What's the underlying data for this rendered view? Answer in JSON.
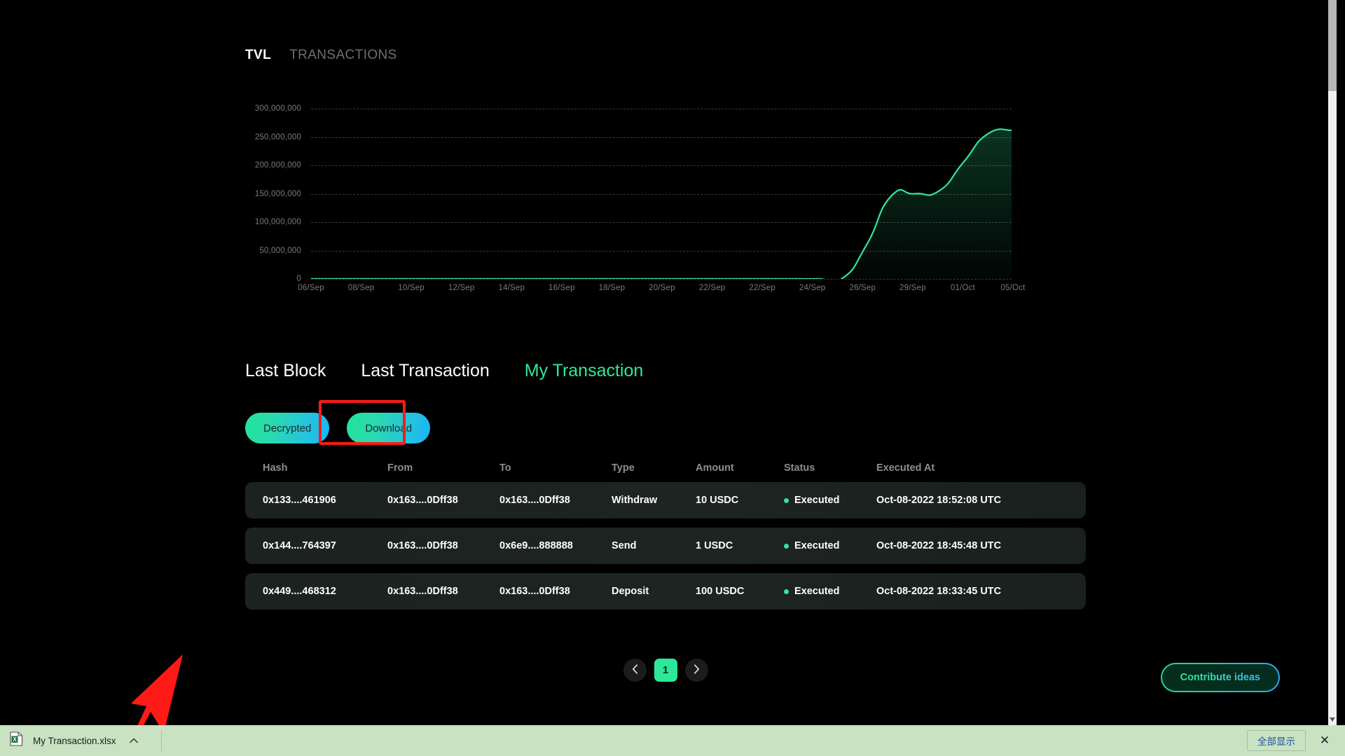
{
  "chart_tabs": [
    {
      "label": "TVL",
      "active": true
    },
    {
      "label": "TRANSACTIONS",
      "active": false
    }
  ],
  "chart_data": {
    "type": "area",
    "title": "TVL",
    "xlabel": "",
    "ylabel": "",
    "ylim": [
      0,
      300000000
    ],
    "grid": true,
    "legend": "none",
    "line_color": "#2ee89a",
    "fill_color": "#0d2b22",
    "ytick_labels": [
      "300,000,000",
      "250,000,000",
      "200,000,000",
      "150,000,000",
      "100,000,000",
      "50,000,000",
      "0"
    ],
    "ytick_values": [
      300000000,
      250000000,
      200000000,
      150000000,
      100000000,
      50000000,
      0
    ],
    "xtick_labels": [
      "06/Sep",
      "08/Sep",
      "10/Sep",
      "12/Sep",
      "14/Sep",
      "16/Sep",
      "18/Sep",
      "20/Sep",
      "22/Sep",
      "22/Sep",
      "24/Sep",
      "26/Sep",
      "29/Sep",
      "01/Oct",
      "05/Oct"
    ],
    "x": [
      "06/Sep",
      "07/Sep",
      "08/Sep",
      "09/Sep",
      "10/Sep",
      "11/Sep",
      "12/Sep",
      "13/Sep",
      "14/Sep",
      "15/Sep",
      "16/Sep",
      "17/Sep",
      "18/Sep",
      "19/Sep",
      "20/Sep",
      "21/Sep",
      "22/Sep",
      "23/Sep",
      "24/Sep",
      "25/Sep",
      "26/Sep",
      "27/Sep",
      "28/Sep",
      "29/Sep",
      "30/Sep",
      "01/Oct",
      "02/Oct",
      "03/Oct",
      "04/Oct",
      "05/Oct"
    ],
    "values": [
      0,
      0,
      0,
      0,
      0,
      0,
      0,
      0,
      0,
      0,
      0,
      0,
      0,
      0,
      0,
      0,
      0,
      0,
      0,
      0,
      0,
      0,
      1000000,
      60000000,
      145000000,
      150000000,
      155000000,
      205000000,
      255000000,
      262000000
    ]
  },
  "section_tabs": [
    {
      "label": "Last Block",
      "active": false
    },
    {
      "label": "Last Transaction",
      "active": false
    },
    {
      "label": "My Transaction",
      "active": true
    }
  ],
  "actions": {
    "decrypted_label": "Decrypted",
    "download_label": "Download"
  },
  "table": {
    "headers": [
      "Hash",
      "From",
      "To",
      "Type",
      "Amount",
      "Status",
      "Executed At"
    ],
    "rows": [
      {
        "hash": "0x133....461906",
        "from": "0x163....0Dff38",
        "to": "0x163....0Dff38",
        "type": "Withdraw",
        "amount": "10 USDC",
        "status": "Executed",
        "executed_at": "Oct-08-2022 18:52:08 UTC"
      },
      {
        "hash": "0x144....764397",
        "from": "0x163....0Dff38",
        "to": "0x6e9....888888",
        "type": "Send",
        "amount": "1 USDC",
        "status": "Executed",
        "executed_at": "Oct-08-2022 18:45:48 UTC"
      },
      {
        "hash": "0x449....468312",
        "from": "0x163....0Dff38",
        "to": "0x163....0Dff38",
        "type": "Deposit",
        "amount": "100 USDC",
        "status": "Executed",
        "executed_at": "Oct-08-2022 18:33:45 UTC"
      }
    ]
  },
  "pagination": {
    "prev_icon": "chevron-left-icon",
    "next_icon": "chevron-right-icon",
    "current_page": "1"
  },
  "contribute": {
    "label": "Contribute ideas"
  },
  "download_bar": {
    "file_icon": "excel-file-icon",
    "filename": "My Transaction.xlsx",
    "chevron_icon": "chevron-up-icon",
    "show_all_label": "全部显示",
    "close_label": "✕"
  },
  "colors": {
    "accent_green": "#2ee89a",
    "accent_cyan": "#18b6f5",
    "highlight_red": "#ff1a17",
    "background": "#000000",
    "row_background": "#1d2422",
    "download_bar": "#c9e2c2"
  }
}
